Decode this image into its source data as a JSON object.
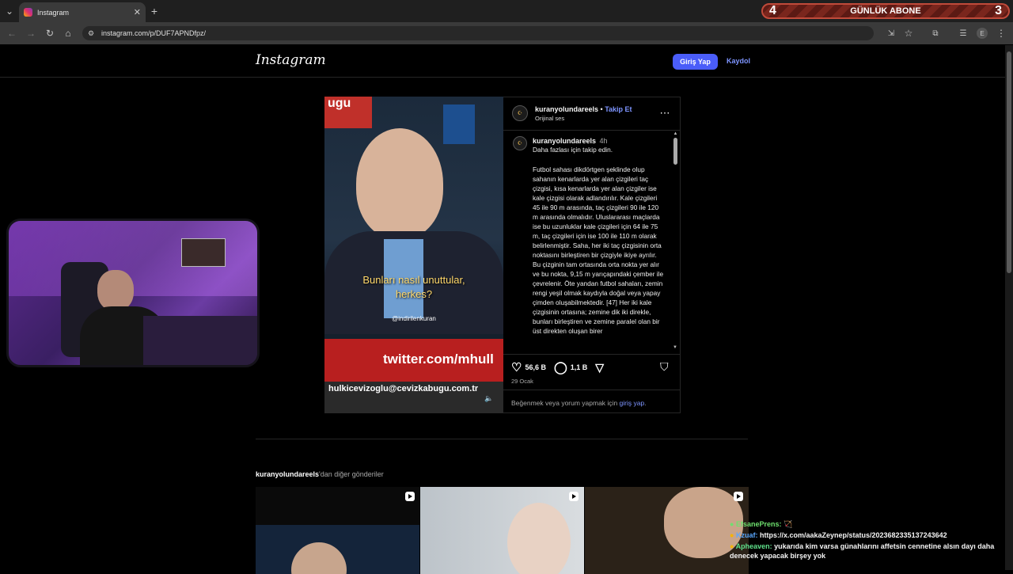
{
  "browser": {
    "tab_title": "Instagram",
    "url": "instagram.com/p/DUF7APNDfpz/"
  },
  "instagram": {
    "logo": "Instagram",
    "login_label": "Giriş Yap",
    "signup_label": "Kaydol"
  },
  "post": {
    "username": "kuranyolundareels",
    "follow_label": "Takip Et",
    "separator": "•",
    "audio": "Orijinal ses",
    "caption_user": "kuranyolundareels",
    "caption_time": "4h",
    "caption_first": "Daha fazlası için takip edin.",
    "caption_body": "Futbol sahası dikdörtgen şeklinde olup sahanın kenarlarda yer alan çizgileri taç çizgisi, kısa kenarlarda yer alan çizgiler ise kale çizgisi olarak adlandırılır. Kale çizgileri 45 ile 90 m arasında, taç çizgileri 90 ile 120 m arasında olmalıdır. Uluslararası maçlarda ise bu uzunluklar kale çizgileri için 64 ile 75 m, taç çizgileri için ise 100 ile 110 m olarak belirlenmiştir. Saha, her iki taç çizgisinin orta noktasını birleştiren bir çizgiyle ikiye ayrılır. Bu çizginin tam ortasında orta nokta yer alır ve bu nokta, 9,15 m yarıçapındaki çember ile çevrelenir. Öte yandan futbol sahaları, zemin rengi yeşil olmak kaydıyla doğal veya yapay çimden oluşabilmektedir. [47] Her iki kale çizgisinin ortasına; zemine dik iki direkle, bunları birleştiren ve zemine paralel olan bir üst direkten oluşan birer",
    "likes": "56,6 B",
    "comments": "1,1 B",
    "date": "29 Ocak",
    "login_prompt": "Beğenmek veya yorum yapmak için",
    "login_link": "giriş yap",
    "login_period": ".",
    "video_subtitle_1": "Bunları nasıl unuttular,",
    "video_subtitle_2": "herkes?",
    "video_watermark": "@indirilenkuran",
    "video_logo": "ugu",
    "video_ticker_1": "twitter.com/mhull",
    "video_ticker_2": "hulkicevizoglu@cevizkabugu.com.tr"
  },
  "more_posts": {
    "heading_user": "kuranyolundareels",
    "heading_rest": "'dan diğer gönderiler"
  },
  "overlay": {
    "banner_left": "4",
    "banner_text": "GÜNLÜK ABONE",
    "banner_right": "3",
    "chat": [
      {
        "user": "EfsanePrens:",
        "user_color": "#6ee06e",
        "message": "🏹"
      },
      {
        "user": "Kzuaf:",
        "user_color": "#5aa8ff",
        "message": "https://x.com/aakaZeynep/status/2023682335137243642"
      },
      {
        "user": "Apheaven:",
        "user_color": "#5ee08a",
        "message": "yukarıda kim varsa günahlarını affetsin cennetine alsın dayı daha denecek yapacak birşey yok"
      }
    ]
  }
}
